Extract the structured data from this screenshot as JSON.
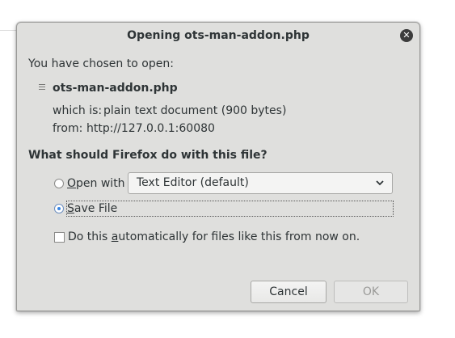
{
  "dialog": {
    "title": "Opening ots-man-addon.php",
    "close_icon": "close-icon",
    "chosen_label": "You have chosen to open:",
    "file_icon": "text-file-icon",
    "file_name": "ots-man-addon.php",
    "which_is_label": "which is:",
    "which_is_value": "plain text document (900 bytes)",
    "from_label": "from:",
    "from_value": "http://127.0.0.1:60080",
    "question": "What should Firefox do with this file?",
    "open_with": {
      "mnemonic": "O",
      "rest": "pen with",
      "selected": false
    },
    "app_select": {
      "value": "Text Editor (default)",
      "arrow_icon": "chevron-down-icon"
    },
    "save_file": {
      "mnemonic": "S",
      "rest": "ave File",
      "selected": true
    },
    "auto_checkbox": {
      "prefix": "Do this ",
      "mnemonic": "a",
      "suffix": "utomatically for files like this from now on.",
      "checked": false
    },
    "cancel_label": "Cancel",
    "ok_label": "OK"
  }
}
